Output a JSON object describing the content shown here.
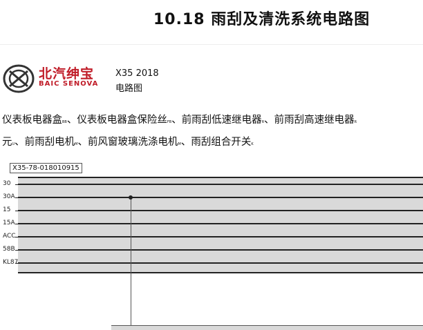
{
  "page": {
    "title": "10.18  雨刮及清洗系统电路图"
  },
  "brand": {
    "name_cn": "北汽绅宝",
    "name_en": "BAIC SENOVA"
  },
  "model": "X35 2018",
  "doc_type": "电路图",
  "components": [
    {
      "name": "仪表板电器盒",
      "code": "BB"
    },
    {
      "name": "仪表板电器盒保险丝",
      "code": "FB"
    },
    {
      "name": "前雨刮低速继电器",
      "code": "R"
    },
    {
      "name": "前雨刮高速继电器",
      "code": "R"
    },
    {
      "name": "元",
      "code": "U"
    },
    {
      "name": "前雨刮电机",
      "code": "M"
    },
    {
      "name": "前风窗玻璃洗涤电机",
      "code": "M"
    },
    {
      "name": "雨刮组合开关",
      "code": "K"
    }
  ],
  "diagram_id": "X35-78-018010915",
  "bus_rails": [
    "30",
    "30A",
    "15",
    "15A",
    "ACC",
    "58B",
    "KL87"
  ]
}
